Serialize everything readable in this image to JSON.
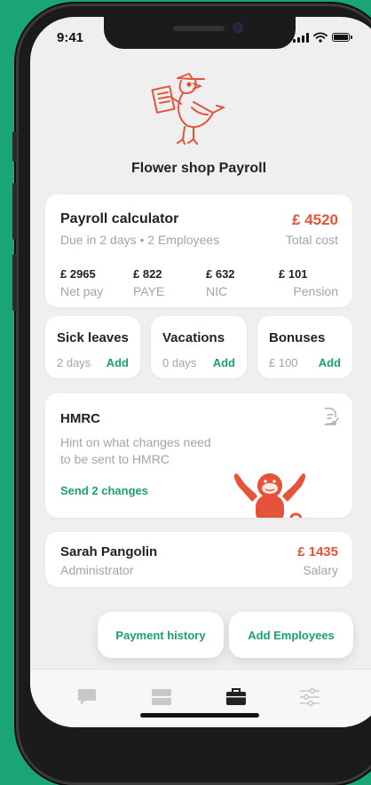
{
  "status_bar": {
    "time": "9:41"
  },
  "header": {
    "company_name": "Flower shop Payroll"
  },
  "payroll": {
    "title": "Payroll calculator",
    "subtitle": "Due in 2 days • 2 Employees",
    "total_value": "£ 4520",
    "total_label": "Total cost",
    "stats": [
      {
        "value": "£ 2965",
        "label": "Net pay"
      },
      {
        "value": "£ 822",
        "label": "PAYE"
      },
      {
        "value": "£ 632",
        "label": "NIC"
      },
      {
        "value": "£ 101",
        "label": "Pension"
      }
    ]
  },
  "mini_cards": [
    {
      "title": "Sick leaves",
      "value": "2 days",
      "action": "Add"
    },
    {
      "title": "Vacations",
      "value": "0 days",
      "action": "Add"
    },
    {
      "title": "Bonuses",
      "value": "£ 100",
      "action": "Add"
    }
  ],
  "hmrc": {
    "title": "HMRC",
    "hint_line1": "Hint on what changes need",
    "hint_line2": "to be sent to HMRC",
    "action": "Send 2 changes",
    "icon": "document-check-icon"
  },
  "employee": {
    "name": "Sarah Pangolin",
    "role": "Administrator",
    "salary_value": "£ 1435",
    "salary_label": "Salary"
  },
  "actions": {
    "payment_history": "Payment history",
    "add_employees": "Add Employees"
  },
  "tabbar": {
    "tabs": [
      "chat-icon",
      "stack-icon",
      "briefcase-icon",
      "sliders-icon"
    ],
    "active_index": 2
  },
  "colors": {
    "accent": "#e5533b",
    "green": "#1a9e73",
    "background": "#1aa579"
  }
}
